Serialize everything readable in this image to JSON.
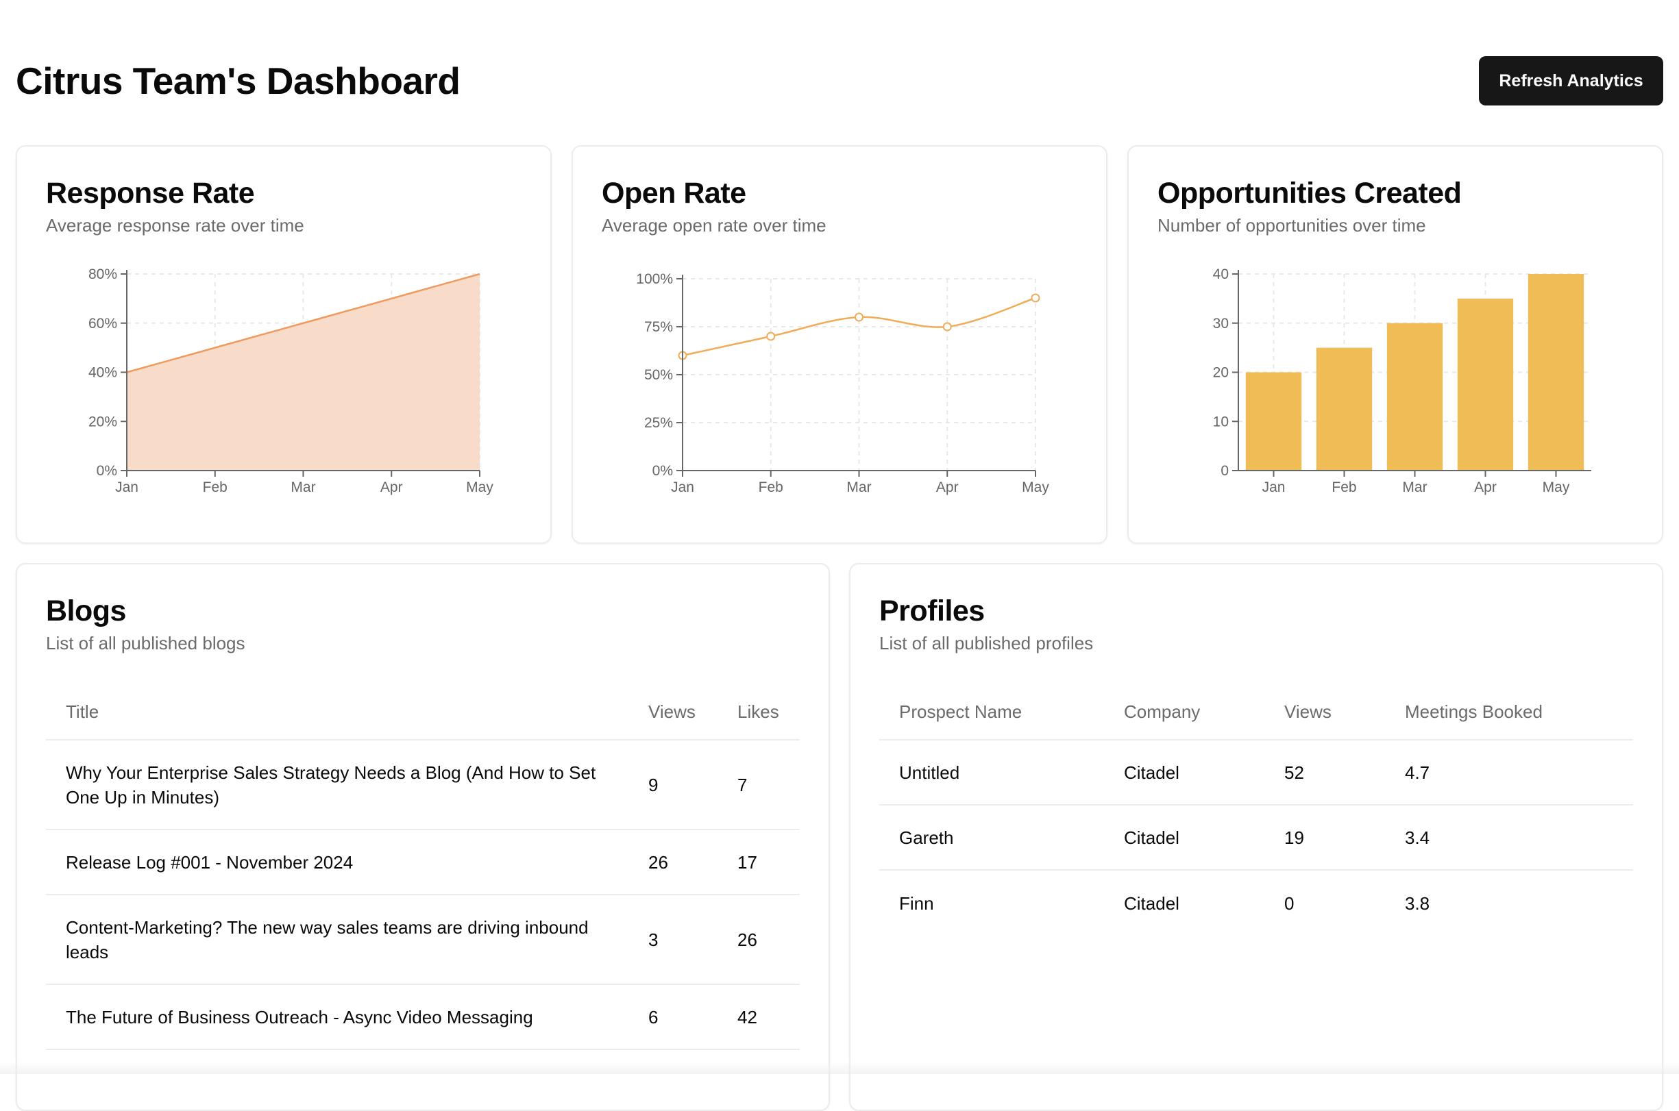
{
  "header": {
    "title": "Citrus Team's Dashboard",
    "refresh_label": "Refresh Analytics"
  },
  "cards": {
    "response": {
      "title": "Response Rate",
      "subtitle": "Average response rate over time"
    },
    "open": {
      "title": "Open Rate",
      "subtitle": "Average open rate over time"
    },
    "opps": {
      "title": "Opportunities Created",
      "subtitle": "Number of opportunities over time"
    }
  },
  "colors": {
    "area_stroke": "#ef9a5e",
    "area_fill": "#f8dcc9",
    "line": "#f0ac58",
    "bar": "#efbc56",
    "grid": "#e8e8e8",
    "axis": "#666666"
  },
  "chart_data": [
    {
      "type": "area",
      "categories": [
        "Jan",
        "Feb",
        "Mar",
        "Apr",
        "May"
      ],
      "series": [
        {
          "values": [
            40,
            50,
            60,
            70,
            80
          ]
        }
      ],
      "yticks": [
        "0%",
        "20%",
        "40%",
        "60%",
        "80%"
      ],
      "ylim": [
        0,
        80
      ],
      "grid": true
    },
    {
      "type": "line",
      "categories": [
        "Jan",
        "Feb",
        "Mar",
        "Apr",
        "May"
      ],
      "series": [
        {
          "values": [
            60,
            70,
            80,
            75,
            90
          ]
        }
      ],
      "yticks": [
        "0%",
        "25%",
        "50%",
        "75%",
        "100%"
      ],
      "ylim": [
        0,
        100
      ],
      "grid": true
    },
    {
      "type": "bar",
      "categories": [
        "Jan",
        "Feb",
        "Mar",
        "Apr",
        "May"
      ],
      "series": [
        {
          "values": [
            20,
            25,
            30,
            35,
            40
          ]
        }
      ],
      "yticks": [
        "0",
        "10",
        "20",
        "30",
        "40"
      ],
      "ylim": [
        0,
        40
      ],
      "grid": true
    }
  ],
  "blogs": {
    "title": "Blogs",
    "subtitle": "List of all published blogs",
    "columns": [
      "Title",
      "Views",
      "Likes"
    ],
    "rows": [
      {
        "title": "Why Your Enterprise Sales Strategy Needs a Blog (And How to Set One Up in Minutes)",
        "views": "9",
        "likes": "7"
      },
      {
        "title": "Release Log #001 - November 2024",
        "views": "26",
        "likes": "17"
      },
      {
        "title": "Content-Marketing? The new way sales teams are driving inbound leads",
        "views": "3",
        "likes": "26"
      },
      {
        "title": "The Future of Business Outreach - Async Video Messaging",
        "views": "6",
        "likes": "42"
      }
    ]
  },
  "profiles": {
    "title": "Profiles",
    "subtitle": "List of all published profiles",
    "columns": [
      "Prospect Name",
      "Company",
      "Views",
      "Meetings Booked"
    ],
    "rows": [
      {
        "name": "Untitled",
        "company": "Citadel",
        "views": "52",
        "meetings": "4.7"
      },
      {
        "name": "Gareth",
        "company": "Citadel",
        "views": "19",
        "meetings": "3.4"
      },
      {
        "name": "Finn",
        "company": "Citadel",
        "views": "0",
        "meetings": "3.8"
      }
    ]
  }
}
